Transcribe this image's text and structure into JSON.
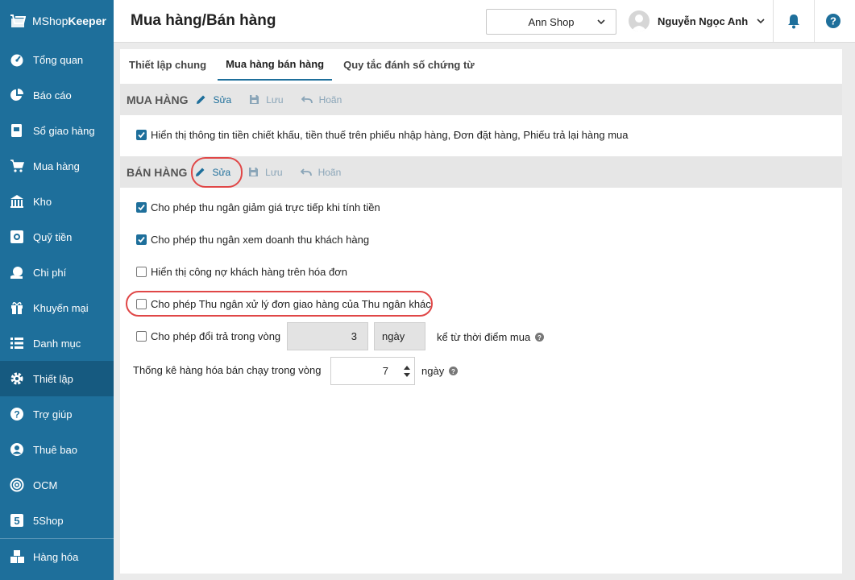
{
  "app": {
    "brand_light": "MShop",
    "brand_bold": "Keeper"
  },
  "sidebar": {
    "items": [
      {
        "label": "Tổng quan",
        "icon": "dashboard-icon"
      },
      {
        "label": "Báo cáo",
        "icon": "pie-chart-icon"
      },
      {
        "label": "Sổ giao hàng",
        "icon": "delivery-book-icon"
      },
      {
        "label": "Mua hàng",
        "icon": "cart-icon"
      },
      {
        "label": "Kho",
        "icon": "warehouse-icon"
      },
      {
        "label": "Quỹ tiền",
        "icon": "cash-fund-icon"
      },
      {
        "label": "Chi phí",
        "icon": "expense-icon"
      },
      {
        "label": "Khuyến mại",
        "icon": "gift-icon"
      },
      {
        "label": "Danh mục",
        "icon": "list-icon"
      },
      {
        "label": "Thiết lập",
        "icon": "gear-icon",
        "active": true
      },
      {
        "label": "Trợ giúp",
        "icon": "help-icon"
      },
      {
        "label": "Thuê bao",
        "icon": "subscription-icon"
      },
      {
        "label": "OCM",
        "icon": "ocm-icon"
      },
      {
        "label": "5Shop",
        "icon": "fiveshop-icon"
      },
      {
        "label": "Hàng hóa",
        "icon": "goods-icon"
      }
    ]
  },
  "header": {
    "title": "Mua hàng/Bán hàng",
    "shop": "Ann Shop",
    "user": "Nguyễn Ngọc Anh"
  },
  "tabs": [
    {
      "label": "Thiết lập chung"
    },
    {
      "label": "Mua hàng bán hàng",
      "active": true
    },
    {
      "label": "Quy tắc đánh số chứng từ"
    }
  ],
  "purchase": {
    "title": "MUA HÀNG",
    "edit": "Sửa",
    "save": "Lưu",
    "cancel": "Hoãn",
    "options": [
      {
        "label": "Hiển thị thông tin tiền chiết khấu, tiền thuế trên phiếu nhập hàng, Đơn đặt hàng, Phiếu trả lại hàng mua",
        "checked": true
      }
    ]
  },
  "sales": {
    "title": "BÁN HÀNG",
    "edit": "Sửa",
    "save": "Lưu",
    "cancel": "Hoãn",
    "options": [
      {
        "label": "Cho phép thu ngân giảm giá trực tiếp khi tính tiền",
        "checked": true
      },
      {
        "label": "Cho phép thu ngân xem doanh thu khách hàng",
        "checked": true
      },
      {
        "label": "Hiển thị công nợ khách hàng trên hóa đơn",
        "checked": false
      },
      {
        "label": "Cho phép Thu ngân xử lý đơn giao hàng của Thu ngân khác",
        "checked": false
      }
    ],
    "return": {
      "label": "Cho phép đổi trả trong vòng",
      "checked": false,
      "value": "3",
      "unit": "ngày",
      "suffix": "kể từ thời điểm mua"
    },
    "bestseller": {
      "label": "Thống kê hàng hóa bán chạy trong vòng",
      "value": "7",
      "unit": "ngày"
    }
  },
  "colors": {
    "sidebar": "#1e6f9b",
    "accent": "#1e6f9b",
    "highlight": "#e04747"
  }
}
